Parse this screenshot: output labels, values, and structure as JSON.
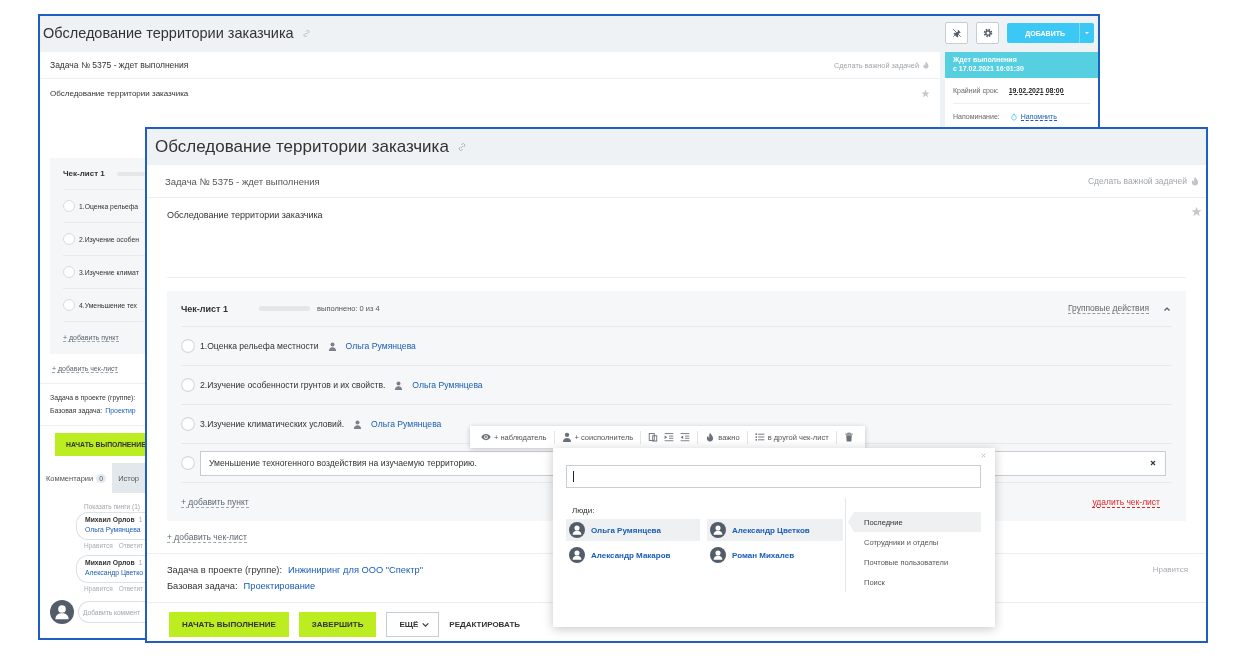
{
  "back_window": {
    "title": "Обследование территории заказчика",
    "add_button": "ДОБАВИТЬ",
    "task_header": "Задача № 5375 - ждет выполнения",
    "make_important": "Сделать важной задачей",
    "description": "Обследование территории заказчика",
    "status_panel": {
      "status": "Ждет выполнения",
      "since": "с 17.02.2021 16:01:30",
      "fields": [
        {
          "kind": "date",
          "label": "Крайний срок:",
          "value": "19.02.2021 08:00"
        },
        {
          "kind": "reminder",
          "label": "Напоминание:",
          "value": "Напомнить"
        }
      ]
    },
    "checklist": {
      "title": "Чек-лист 1",
      "level": 0,
      "items": [
        {
          "text": "1.Оценка рельефа",
          "checked": false
        },
        {
          "text": "2.Изучение особен",
          "checked": false
        },
        {
          "text": "3.Изучение климат",
          "checked": false
        },
        {
          "text": "4.Уменьшение тех",
          "checked": false
        }
      ],
      "add_item": "+ добавить пункт"
    },
    "add_checklist": "+ добавить чек-лист",
    "project_label": "Задача в проекте (группе):",
    "base_task_label": "Базовая задача:",
    "base_task_value": "Проектир",
    "start_button": "НАЧАТЬ ВЫПОЛНЕНИЕ",
    "tabs": [
      {
        "label": "Комментарии",
        "count": "0",
        "selected": true
      },
      {
        "label": "Истор",
        "selected": false
      }
    ],
    "show_pings": "Показать пинги (1)",
    "comments": [
      {
        "author": "Михаил Орлов",
        "time": "1",
        "text": "Ольга Румянцева",
        "actions": [
          "Нравится",
          "Ответит"
        ]
      },
      {
        "author": "Михаил Орлов",
        "time": "1",
        "text": "Александр Цветко",
        "actions": [
          "Нравится",
          "Ответит"
        ]
      }
    ],
    "comment_placeholder": "Добавить коммент"
  },
  "front_window": {
    "title": "Обследование территории заказчика",
    "task_header": "Задача № 5375 - ждет выполнения",
    "make_important": "Сделать важной задачей",
    "description": "Обследование территории заказчика",
    "checklist": {
      "title": "Чек-лист 1",
      "level": 0,
      "progress": "выполнено: 0 из 4",
      "group_actions": "Групповые действия",
      "expanded": true,
      "items": [
        {
          "text": "1.Оценка рельефа местности",
          "assignee": "Ольга Румянцева",
          "checked": false,
          "editing": false
        },
        {
          "text": "2.Изучение особенности грунтов и их свойств.",
          "assignee": "Ольга Румянцева",
          "checked": false,
          "editing": false
        },
        {
          "text": "3.Изучение климатических условий.",
          "assignee": "Ольга Румянцева",
          "checked": false,
          "editing": false
        },
        {
          "text": "Уменьшение техногенного воздействия на изучаемую территорию.",
          "checked": false,
          "editing": true
        }
      ],
      "add_item": "+ добавить пункт",
      "delete": "удалить чек-лист"
    },
    "add_checklist": "+ добавить чек-лист",
    "project_label": "Задача в проекте (группе):",
    "project_value": "Инжиниринг для ООО \"Спектр\"",
    "base_task_label": "Базовая задача:",
    "base_task_value": "Проектирование",
    "like": "Нравится",
    "buttons": [
      {
        "label": "НАЧАТЬ ВЫПОЛНЕНИЕ",
        "kind": "primary"
      },
      {
        "label": "ЗАВЕРШИТЬ",
        "kind": "primary"
      },
      {
        "label": "ЕЩЁ",
        "kind": "dropdown"
      },
      {
        "label": "РЕДАКТИРОВАТЬ",
        "kind": "link"
      }
    ],
    "item_toolbar": [
      [
        {
          "kind": "eye",
          "label": "+ наблюдатель"
        }
      ],
      [
        {
          "kind": "person",
          "label": "+ соисполнитель"
        }
      ],
      [
        {
          "kind": "paste"
        },
        {
          "kind": "indent"
        },
        {
          "kind": "outdent"
        }
      ],
      [
        {
          "kind": "flame",
          "label": "важно"
        }
      ],
      [
        {
          "kind": "list",
          "label": "в другой чек-лист"
        }
      ],
      [
        {
          "kind": "trash"
        }
      ]
    ],
    "people_picker": {
      "people_label": "Люди:",
      "people": [
        {
          "name": "Ольга Румянцева",
          "selected": true
        },
        {
          "name": "Александр Цветков",
          "selected": true
        },
        {
          "name": "Александр Макаров",
          "selected": false
        },
        {
          "name": "Роман Михалев",
          "selected": false
        }
      ],
      "sources": [
        {
          "label": "Последние",
          "selected": true
        },
        {
          "label": "Сотрудники и отделы",
          "selected": false
        },
        {
          "label": "Почтовые пользователи",
          "selected": false
        },
        {
          "label": "Поиск",
          "selected": false
        }
      ]
    }
  }
}
